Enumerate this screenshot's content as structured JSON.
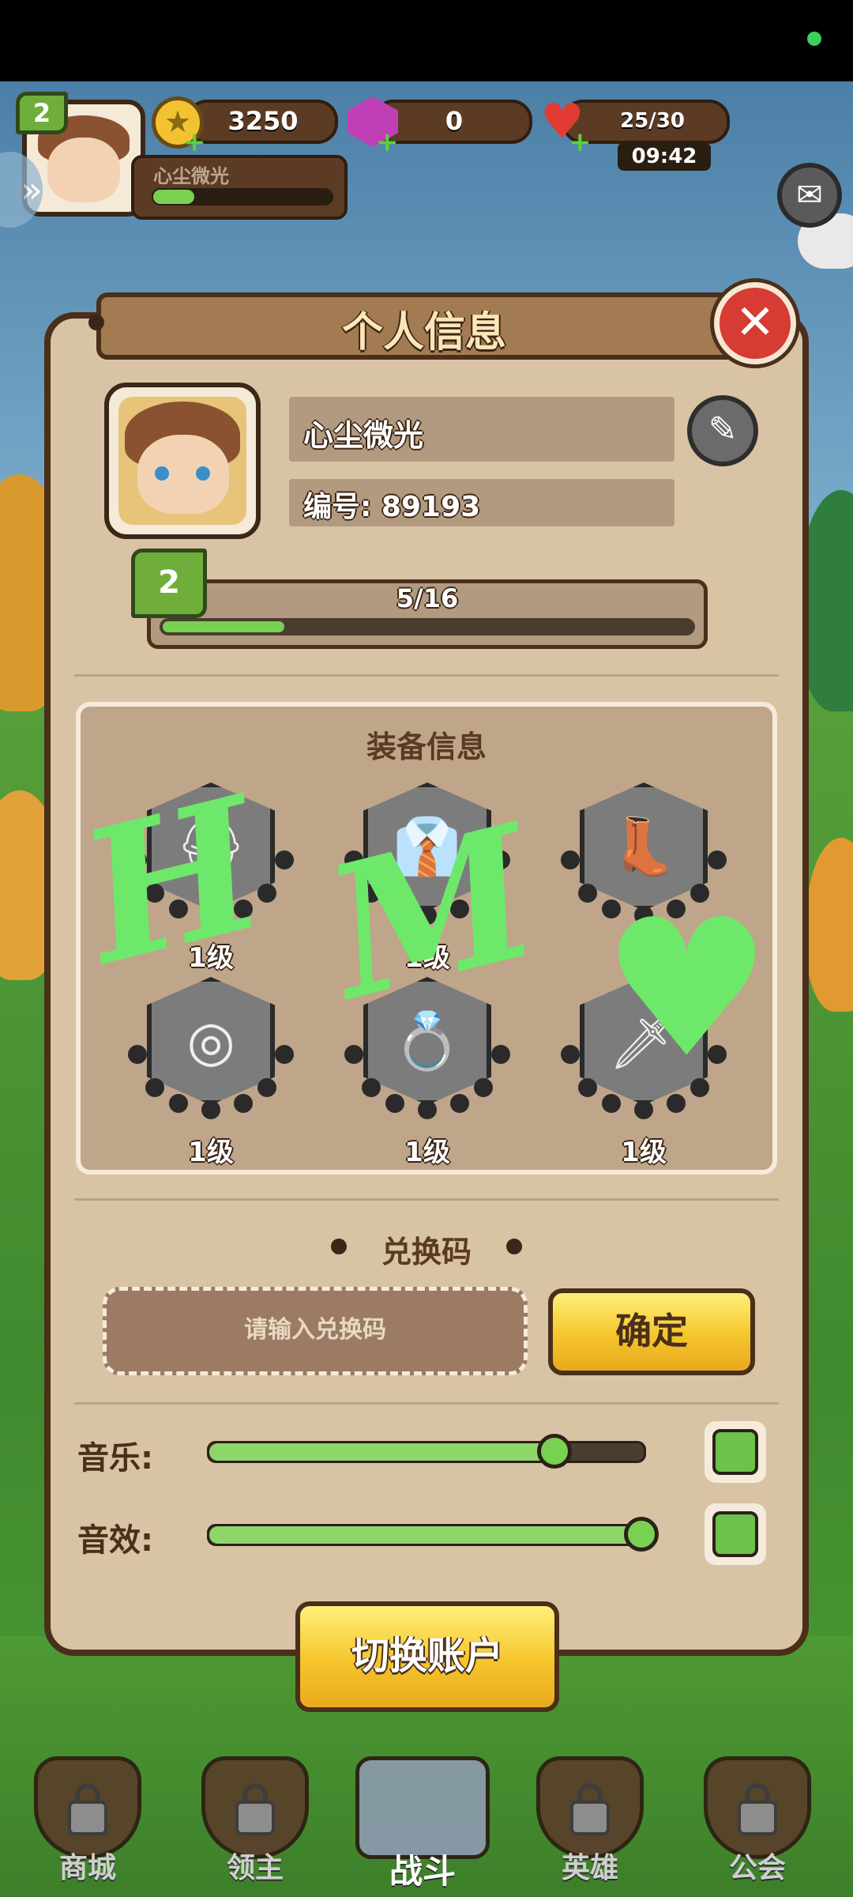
{
  "hud": {
    "player_level": "2",
    "player_name": "心尘微光",
    "gold": "3250",
    "gems": "0",
    "energy": "25/30",
    "energy_timer": "09:42"
  },
  "dialog": {
    "title": "个人信息",
    "profile": {
      "name": "心尘微光",
      "id_label": "编号: 89193",
      "level": "2",
      "xp_text": "5/16",
      "xp_progress": 0.23
    },
    "equipment": {
      "title": "装备信息",
      "slots": [
        {
          "icon": "helmet-icon",
          "level": "1级"
        },
        {
          "icon": "armor-icon",
          "level": "1级"
        },
        {
          "icon": "boots-icon",
          "level": "1级"
        },
        {
          "icon": "necklace-icon",
          "level": "1级"
        },
        {
          "icon": "ring-icon",
          "level": "1级"
        },
        {
          "icon": "sword-icon",
          "level": "1级"
        }
      ]
    },
    "redeem": {
      "title": "兑换码",
      "placeholder": "请输入兑换码",
      "confirm_label": "确定"
    },
    "settings": {
      "music_label": "音乐:",
      "music_level": 0.8,
      "sfx_label": "音效:",
      "sfx_level": 1.0
    },
    "switch_account_label": "切换账户"
  },
  "bottom_nav": [
    {
      "label": "商城",
      "locked": true
    },
    {
      "label": "领主",
      "locked": true
    },
    {
      "label": "战斗",
      "locked": false
    },
    {
      "label": "英雄",
      "locked": true
    },
    {
      "label": "公会",
      "locked": true
    }
  ],
  "colors": {
    "accent_green": "#79d152",
    "panel": "#d9c3a5",
    "button_yellow": "#f5c52b",
    "close_red": "#d63b34"
  }
}
